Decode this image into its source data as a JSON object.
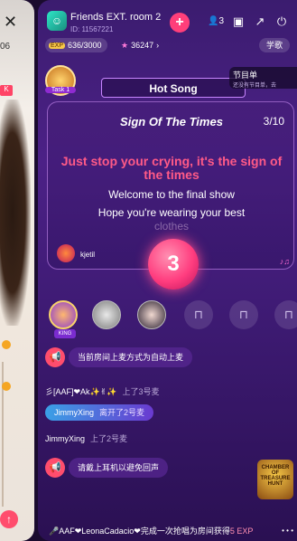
{
  "left_card": {
    "close_glyph": "✕",
    "number": "06",
    "tag": "K"
  },
  "room": {
    "title": "Friends EXT. room 2",
    "id": "ID: 11567221",
    "member_count": "3",
    "exp": "636/3000",
    "exp_level": "EXP",
    "coins": "36247",
    "language_button": "学歌",
    "task_label": "Task 1"
  },
  "hot_song": {
    "label": "Hot Song"
  },
  "playlist": {
    "title": "节目单",
    "subtitle": "还没有节目单，去"
  },
  "lyrics": {
    "song_name": "Sign Of The Times",
    "progress": "3/10",
    "current_line": "Just stop your crying, it's the sign of the times",
    "next_line_1": "Welcome to the final show",
    "next_line_2": "Hope you're wearing your best",
    "next_line_3": "clothes",
    "singer": "kjetil",
    "countdown": "3"
  },
  "seats": {
    "host_tag": "KING"
  },
  "chat": {
    "system_message_1": "当前房间上麦方式为自动上麦",
    "line_1_user": "彡[AAF]❤Ak✨✌✨",
    "line_1_action": "上了3号麦",
    "join_user": "JimmyXing",
    "join_action": "离开了2号麦",
    "line_3_user": "JimmyXing",
    "line_3_action": "上了2号麦",
    "system_message_2": "请戴上耳机以避免回声"
  },
  "treasure": {
    "label": "CHAMBER OF TREASURE HUNT"
  },
  "marquee": {
    "text": "🎤AAF❤LeonaCadacio❤完成一次抢唱为房间获得",
    "exp": "5 EXP"
  },
  "colors": {
    "accent_pink": "#ff3f7a",
    "lyric_active": "#ff5a87",
    "background": "#4c2187"
  }
}
